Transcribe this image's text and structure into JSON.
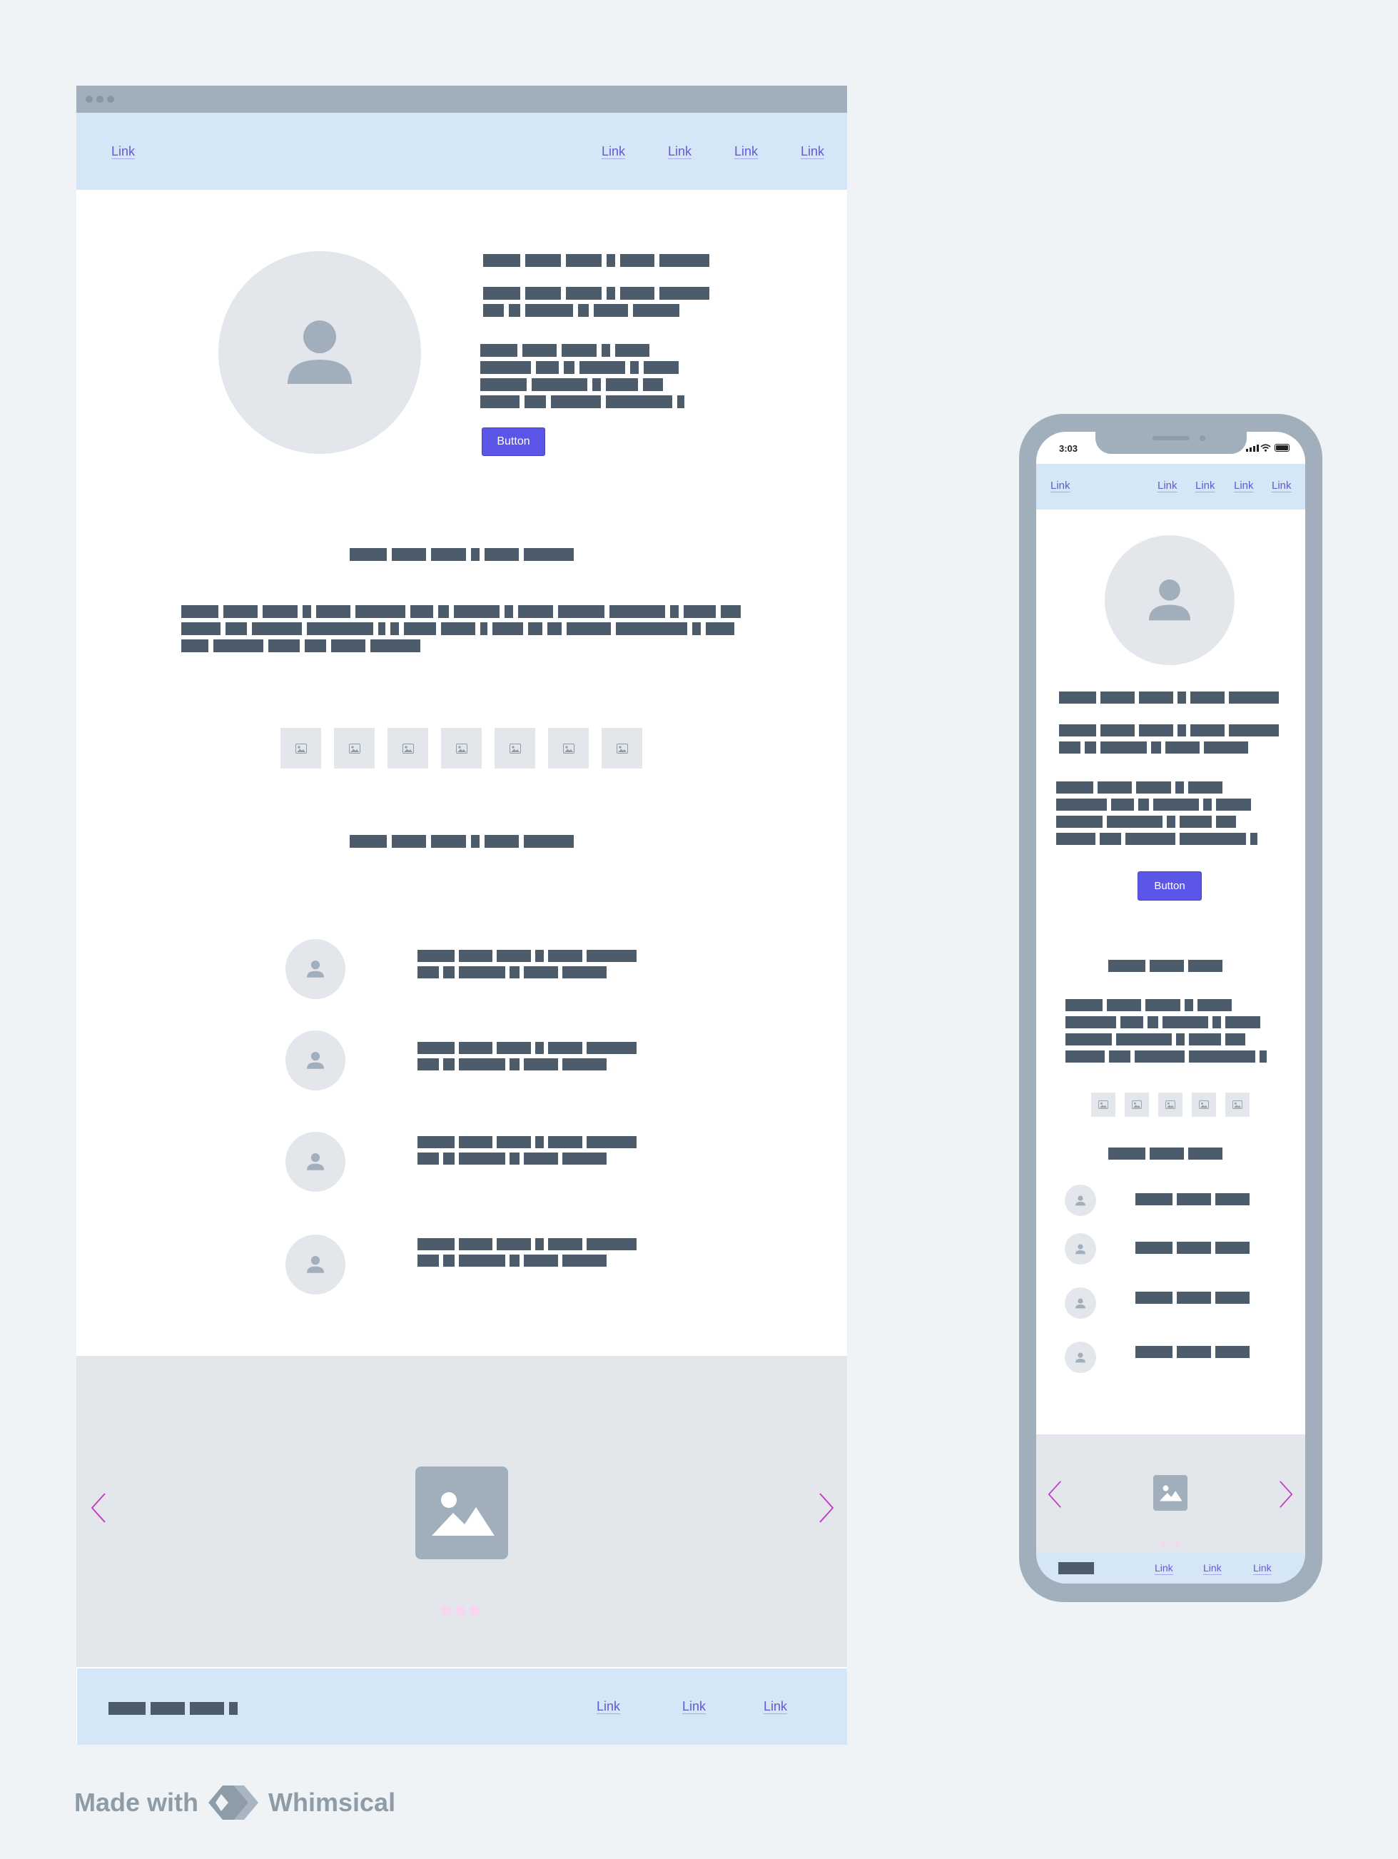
{
  "desktop": {
    "nav": {
      "left_link": "Link",
      "right_links": [
        "Link",
        "Link",
        "Link",
        "Link"
      ]
    },
    "hero": {
      "button_label": "Button"
    },
    "footer": {
      "links": [
        "Link",
        "Link",
        "Link"
      ]
    }
  },
  "phone": {
    "status": {
      "time": "3:03"
    },
    "nav": {
      "left_link": "Link",
      "right_links": [
        "Link",
        "Link",
        "Link",
        "Link"
      ]
    },
    "hero": {
      "button_label": "Button"
    },
    "footer": {
      "links": [
        "Link",
        "Link",
        "Link"
      ]
    }
  },
  "brand": {
    "prefix": "Made with",
    "name": "Whimsical"
  },
  "icons": {
    "avatar": "person-icon",
    "thumbnail": "image-icon",
    "carousel": "image-icon",
    "prev": "chevron-left-icon",
    "next": "chevron-right-icon"
  },
  "colors": {
    "accent": "#5b55e8",
    "link": "#5f5bd6",
    "chevron": "#c23fc4",
    "nav_bg": "#d5e6f6",
    "placeholder_text": "#4c5c6b",
    "frame": "#a0afbb"
  }
}
